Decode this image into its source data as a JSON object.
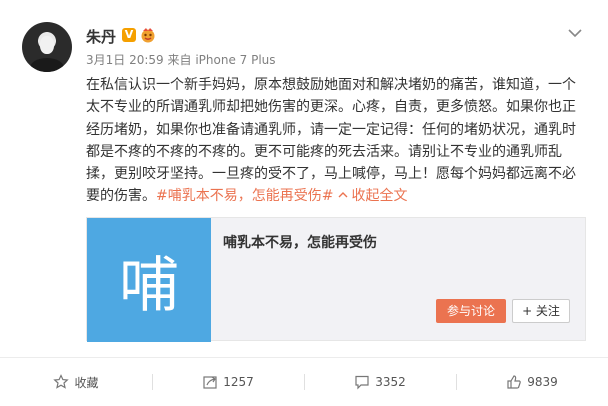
{
  "post": {
    "author": "朱丹",
    "timestamp": "3月1日 20:59",
    "source": "来自 iPhone 7 Plus",
    "lines": [
      "在私信认识一个新手妈妈，原本想鼓励她面对和解决堵奶的痛苦，谁知道，一个",
      "太不专业的所谓通乳师却把她伤害的更深。心疼，自责，更多愤怒。如果你也正",
      "经历堵奶，如果你也准备请通乳师，请一定一定记得：任何的堵奶状况，通乳时",
      "都是不疼的不疼的不疼的。更不可能疼的死去活来。请别让不专业的通乳师乱",
      "揉，更别咬牙坚持。一旦疼的受不了，马上喊停，马上！愿每个妈妈都远离不必"
    ],
    "last_line_text": "要的伤害。",
    "hashtag": "#哺乳本不易，怎能再受伤#",
    "collapse": "收起全文",
    "badge_icon": "verified-v-icon",
    "accent_color": "#eb7350"
  },
  "card": {
    "image_char": "哺",
    "title": "哺乳本不易，怎能再受伤",
    "join_label": "参与讨论",
    "follow_label": "+ 关注",
    "image_color": "#4ea8e2"
  },
  "footer": {
    "favorite_label": "收藏",
    "share_count": "1257",
    "comment_count": "3352",
    "like_count": "9839"
  }
}
